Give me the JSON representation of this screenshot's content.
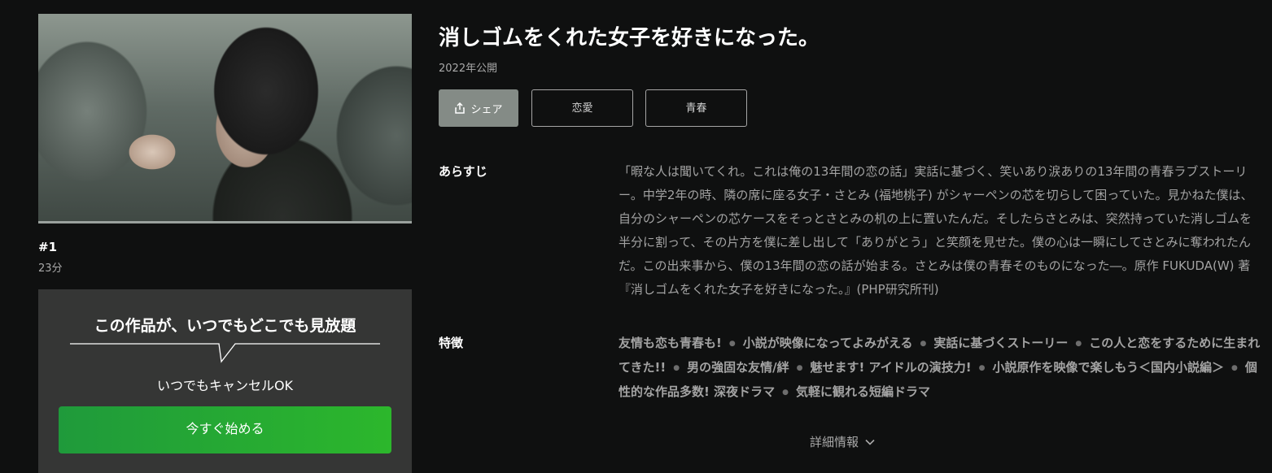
{
  "episode": {
    "number": "#1",
    "duration": "23分"
  },
  "promo": {
    "headline": "この作品が、いつでもどこでも見放題",
    "subtext": "いつでもキャンセルOK",
    "start_label": "今すぐ始める"
  },
  "work": {
    "title": "消しゴムをくれた女子を好きになった。",
    "year": "2022年公開"
  },
  "actions": {
    "share_label": "シェア",
    "share_icon": "share-icon",
    "tags": [
      "恋愛",
      "青春"
    ]
  },
  "synopsis": {
    "label": "あらすじ",
    "text": "「暇な人は聞いてくれ。これは俺の13年間の恋の話」実話に基づく、笑いあり涙ありの13年間の青春ラブストーリー。中学2年の時、隣の席に座る女子・さとみ (福地桃子) がシャーペンの芯を切らして困っていた。見かねた僕は、自分のシャーペンの芯ケースをそっとさとみの机の上に置いたんだ。そしたらさとみは、突然持っていた消しゴムを半分に割って、その片方を僕に差し出して「ありがとう」と笑顔を見せた。僕の心は一瞬にしてさとみに奪われたんだ。この出来事から、僕の13年間の恋の話が始まる。さとみは僕の青春そのものになった―。原作 FUKUDA(W) 著『消しゴムをくれた女子を好きになった。』(PHP研究所刊)"
  },
  "features": {
    "label": "特徴",
    "items": [
      "友情も恋も青春も!",
      "小説が映像になってよみがえる",
      "実話に基づくストーリー",
      "この人と恋をするために生まれてきた!!",
      "男の強固な友情/絆",
      "魅せます! アイドルの演技力!",
      "小説原作を映像で楽しもう＜国内小説編＞",
      "個性的な作品多数! 深夜ドラマ",
      "気軽に観れる短編ドラマ"
    ]
  },
  "details": {
    "label": "詳細情報",
    "icon": "chevron-down-icon"
  },
  "colors": {
    "background": "#0f1010",
    "promo_panel": "#353635",
    "start_gradient_from": "#1f9a3b",
    "start_gradient_to": "#2cb72c",
    "share_button": "#848b86",
    "muted_text": "#a3a3a3"
  }
}
